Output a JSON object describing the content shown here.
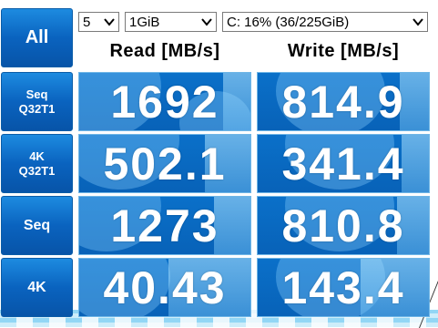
{
  "controls": {
    "all_label": "All",
    "count_value": "5",
    "size_value": "1GiB",
    "drive_value": "C: 16% (36/225GiB)"
  },
  "headers": {
    "read": "Read [MB/s]",
    "write": "Write [MB/s]"
  },
  "tests": [
    {
      "line1": "Seq",
      "line2": "Q32T1",
      "read": "1692",
      "write": "814.9"
    },
    {
      "line1": "4K",
      "line2": "Q32T1",
      "read": "502.1",
      "write": "341.4"
    },
    {
      "line1": "Seq",
      "line2": "",
      "read": "1273",
      "write": "810.8"
    },
    {
      "line1": "4K",
      "line2": "",
      "read": "40.43",
      "write": "143.4"
    }
  ],
  "icons": {
    "dropdown": "chevron-down-icon"
  },
  "colors": {
    "button_blue": "#0a63bf",
    "cell_blue": "#0a70c9",
    "cell_highlight": "#9fdcfa"
  }
}
